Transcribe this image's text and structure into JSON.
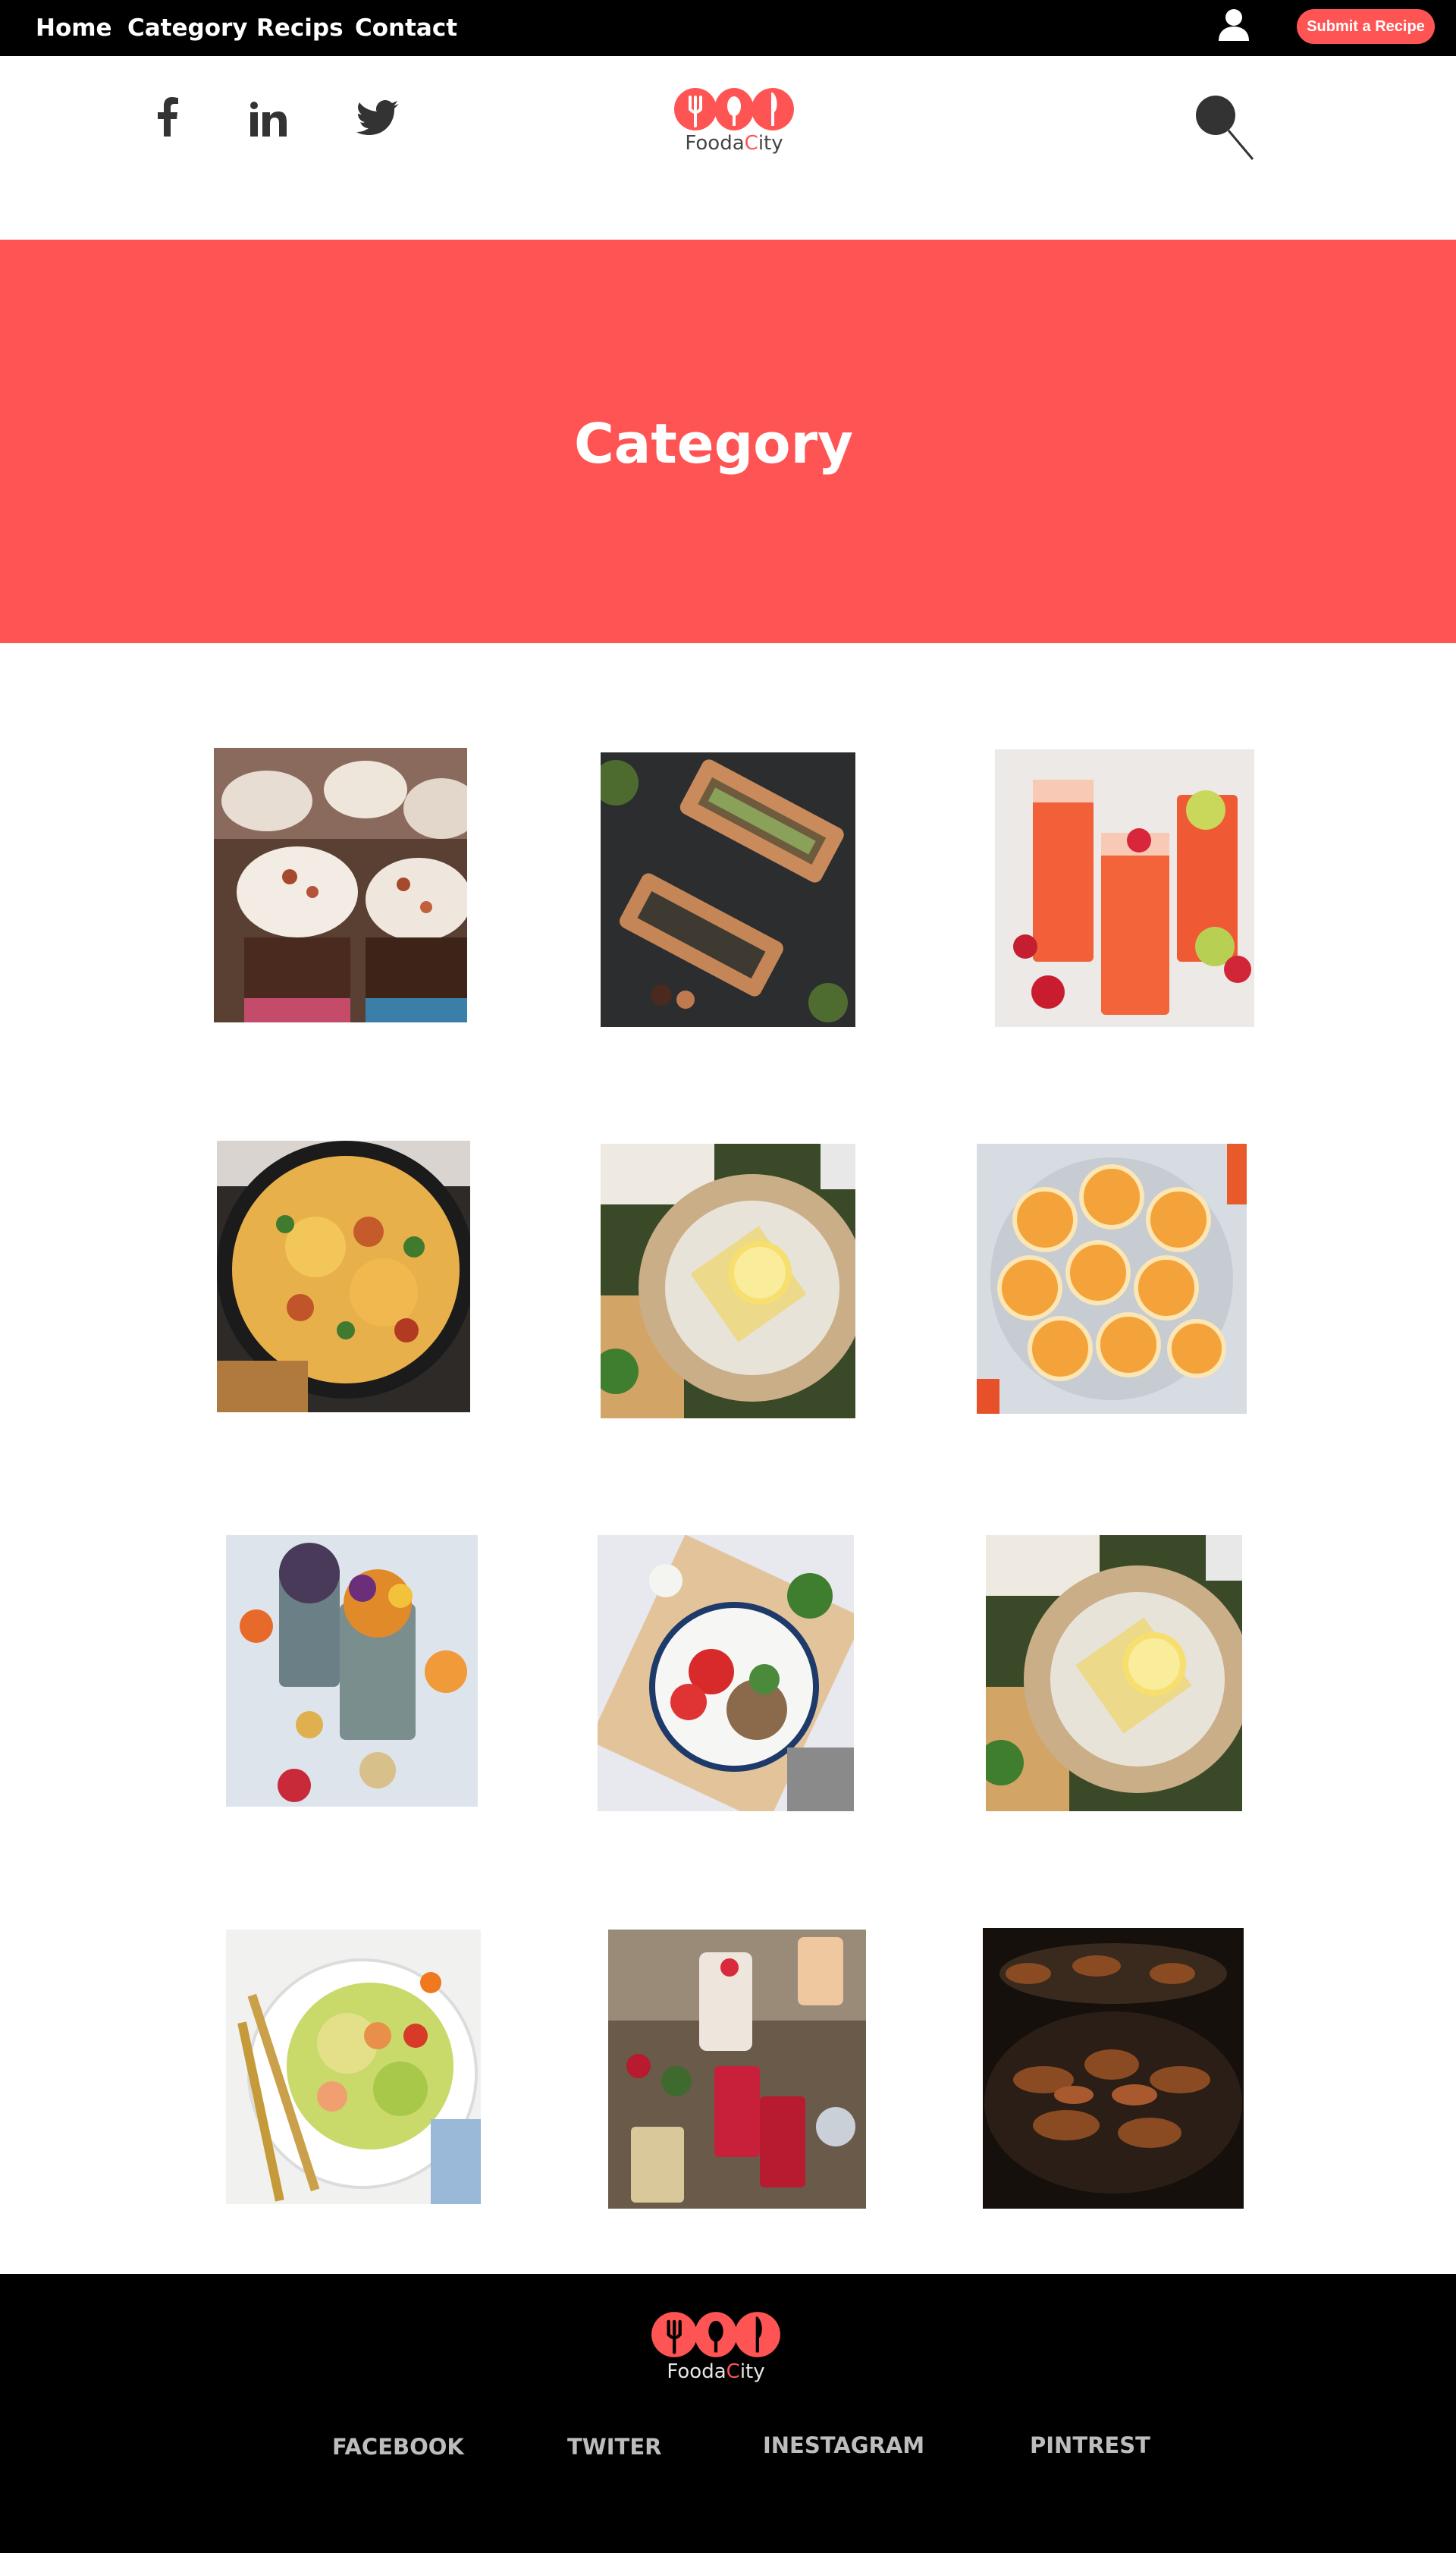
{
  "nav": {
    "links": [
      "Home",
      "Category",
      "Recips",
      "Contact"
    ],
    "submit_label": "Submit a Recipe"
  },
  "header": {
    "social_icons": [
      "facebook-icon",
      "linkedin-icon",
      "twitter-icon"
    ],
    "logo": {
      "text_before": "Fooda",
      "text_accent": "C",
      "text_after": "ity"
    }
  },
  "hero": {
    "title": "Category"
  },
  "categories": [
    {
      "image": "cupcakes"
    },
    {
      "image": "sushi-boards"
    },
    {
      "image": "strawberry-drinks"
    },
    {
      "image": "cheesy-skillet"
    },
    {
      "image": "lemon-cake-plate"
    },
    {
      "image": "swirl-cookies"
    },
    {
      "image": "smoothie-bowls"
    },
    {
      "image": "tomato-salad-plate"
    },
    {
      "image": "lemon-cake-plate"
    },
    {
      "image": "fresh-salad"
    },
    {
      "image": "berry-cocktails"
    },
    {
      "image": "barbecue-grill"
    }
  ],
  "footer": {
    "logo": {
      "text_before": "Fooda",
      "text_accent": "C",
      "text_after": "ity"
    },
    "links": [
      "FACEBOOK",
      "TWITER",
      "INESTAGRAM",
      "PINTREST"
    ]
  },
  "colors": {
    "accent": "#fe5554",
    "nav_bg": "#000000",
    "footer_link": "#bdbdbd"
  }
}
